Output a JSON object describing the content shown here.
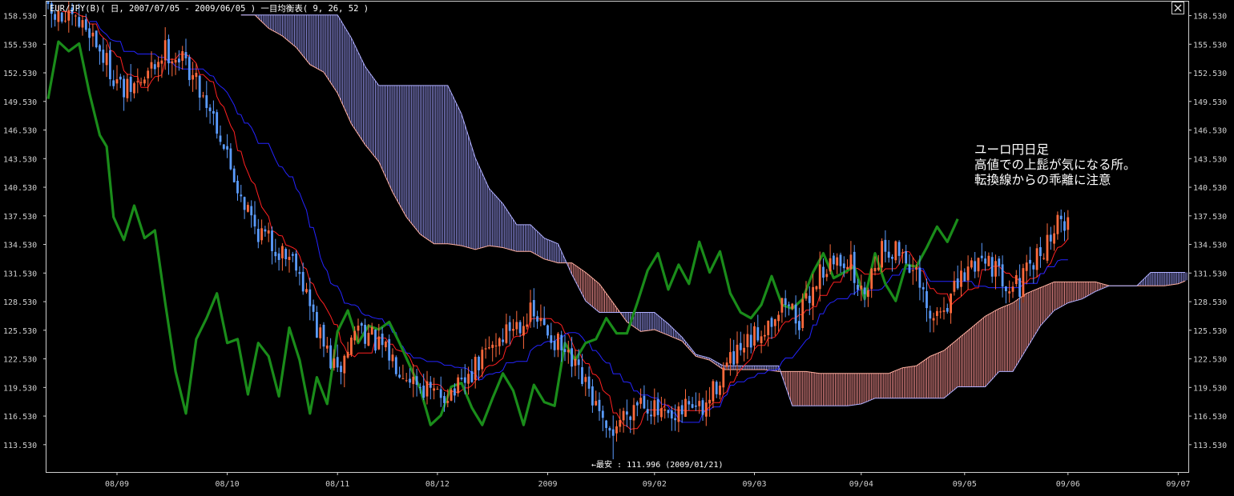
{
  "header": {
    "title": "EUR/JPY(B)( 日, 2007/07/05 - 2009/06/05 )   一目均衡表( 9, 26, 52 )"
  },
  "annotation": {
    "lines": [
      "ユーロ円日足",
      "高値での上髭が気になる所。",
      "転換線からの乖離に注意"
    ]
  },
  "low_marker": {
    "label": "←最安 : 111.996 (2009/01/21)",
    "value": 111.996,
    "date": "2009/01/21"
  },
  "colors": {
    "background": "#000000",
    "bull_candle": "#ff6a3c",
    "bear_candle": "#5b9cff",
    "tenkan": "#ff2020",
    "kijun": "#2424ff",
    "chikou": "#1a8c1a",
    "cloud_bearish": "#8f8fe6",
    "cloud_bullish": "#f08c8c",
    "axis_text": "#d0d0d0"
  },
  "chart_data": {
    "type": "candlestick",
    "indicator": "一目均衡表( 9, 26, 52 )",
    "symbol": "EUR/JPY(B)",
    "period": "2007/07/05 - 2009/06/05",
    "y_ticks": [
      "158.530",
      "155.530",
      "152.530",
      "149.530",
      "146.530",
      "143.530",
      "140.530",
      "137.530",
      "134.530",
      "131.530",
      "128.530",
      "125.530",
      "122.530",
      "119.530",
      "116.530",
      "113.530"
    ],
    "x_ticks": [
      "08/09",
      "08/10",
      "08/11",
      "08/12",
      "2009",
      "09/02",
      "09/03",
      "09/04",
      "09/05",
      "09/06",
      "09/07"
    ],
    "x_tick_index": [
      20,
      52,
      84,
      113,
      145,
      176,
      205,
      236,
      266,
      296,
      328
    ],
    "ylim": [
      111.2,
      160.0
    ],
    "n_bars": 330,
    "price_anchors": [
      [
        0,
        158.6
      ],
      [
        12,
        157.2
      ],
      [
        16,
        154.2
      ],
      [
        22,
        150.4
      ],
      [
        28,
        151.8
      ],
      [
        34,
        155.0
      ],
      [
        40,
        153.6
      ],
      [
        48,
        148.2
      ],
      [
        54,
        141.6
      ],
      [
        60,
        136.4
      ],
      [
        66,
        134.2
      ],
      [
        72,
        133.0
      ],
      [
        78,
        125.6
      ],
      [
        84,
        120.8
      ],
      [
        90,
        126.2
      ],
      [
        96,
        123.8
      ],
      [
        104,
        121.2
      ],
      [
        112,
        118.6
      ],
      [
        120,
        119.4
      ],
      [
        128,
        123.6
      ],
      [
        134,
        125.8
      ],
      [
        140,
        127.2
      ],
      [
        146,
        125.0
      ],
      [
        152,
        121.8
      ],
      [
        158,
        118.4
      ],
      [
        162,
        114.2
      ],
      [
        166,
        116.2
      ],
      [
        172,
        118.6
      ],
      [
        178,
        116.4
      ],
      [
        182,
        115.6
      ],
      [
        186,
        118.2
      ],
      [
        190,
        116.8
      ],
      [
        196,
        121.4
      ],
      [
        202,
        123.4
      ],
      [
        208,
        126.0
      ],
      [
        214,
        128.6
      ],
      [
        218,
        126.6
      ],
      [
        224,
        131.8
      ],
      [
        232,
        133.2
      ],
      [
        236,
        129.2
      ],
      [
        242,
        134.2
      ],
      [
        248,
        133.8
      ],
      [
        252,
        131.0
      ],
      [
        256,
        126.2
      ],
      [
        262,
        129.0
      ],
      [
        268,
        132.4
      ],
      [
        272,
        133.6
      ],
      [
        276,
        131.2
      ],
      [
        282,
        130.2
      ],
      [
        288,
        133.6
      ],
      [
        292,
        136.2
      ],
      [
        296,
        137.4
      ]
    ],
    "chikou_anchors": [
      [
        0,
        149.8
      ],
      [
        3,
        155.8
      ],
      [
        6,
        154.8
      ],
      [
        9,
        155.6
      ],
      [
        12,
        150.4
      ],
      [
        15,
        146.0
      ],
      [
        17,
        144.8
      ],
      [
        19,
        137.4
      ],
      [
        22,
        135.0
      ],
      [
        25,
        138.6
      ],
      [
        28,
        135.2
      ],
      [
        31,
        136.0
      ],
      [
        34,
        128.4
      ],
      [
        37,
        121.2
      ],
      [
        40,
        116.8
      ],
      [
        43,
        124.6
      ],
      [
        46,
        126.8
      ],
      [
        49,
        129.4
      ],
      [
        52,
        124.2
      ],
      [
        55,
        124.6
      ],
      [
        58,
        118.8
      ],
      [
        61,
        124.2
      ],
      [
        64,
        122.8
      ],
      [
        67,
        118.6
      ],
      [
        70,
        125.8
      ],
      [
        73,
        122.4
      ],
      [
        76,
        116.8
      ],
      [
        78,
        120.6
      ],
      [
        81,
        117.8
      ],
      [
        84,
        125.4
      ],
      [
        87,
        127.6
      ],
      [
        90,
        124.2
      ],
      [
        93,
        126.0
      ],
      [
        96,
        125.6
      ],
      [
        99,
        126.4
      ],
      [
        102,
        124.2
      ],
      [
        105,
        121.8
      ],
      [
        108,
        119.4
      ],
      [
        111,
        115.6
      ],
      [
        114,
        116.6
      ],
      [
        117,
        119.6
      ],
      [
        120,
        120.0
      ],
      [
        123,
        117.4
      ],
      [
        126,
        115.6
      ],
      [
        129,
        118.4
      ],
      [
        132,
        121.0
      ],
      [
        135,
        119.2
      ],
      [
        138,
        115.6
      ],
      [
        141,
        119.8
      ],
      [
        144,
        118.0
      ],
      [
        147,
        117.6
      ],
      [
        150,
        124.2
      ],
      [
        153,
        122.4
      ],
      [
        156,
        124.2
      ],
      [
        159,
        124.6
      ],
      [
        162,
        126.8
      ],
      [
        165,
        125.2
      ],
      [
        168,
        125.2
      ],
      [
        171,
        128.4
      ],
      [
        174,
        131.8
      ],
      [
        177,
        133.6
      ],
      [
        180,
        129.8
      ],
      [
        183,
        132.4
      ],
      [
        186,
        130.4
      ],
      [
        189,
        134.8
      ],
      [
        192,
        131.6
      ],
      [
        195,
        133.8
      ],
      [
        198,
        129.4
      ],
      [
        201,
        127.4
      ],
      [
        204,
        126.8
      ],
      [
        207,
        128.2
      ],
      [
        210,
        131.2
      ],
      [
        213,
        128.2
      ],
      [
        216,
        127.8
      ],
      [
        219,
        128.8
      ],
      [
        222,
        131.6
      ],
      [
        225,
        133.6
      ],
      [
        228,
        131.0
      ],
      [
        231,
        131.6
      ],
      [
        234,
        132.2
      ],
      [
        237,
        128.8
      ],
      [
        240,
        133.6
      ],
      [
        243,
        130.4
      ],
      [
        246,
        128.6
      ],
      [
        249,
        132.4
      ],
      [
        252,
        132.2
      ],
      [
        255,
        134.2
      ],
      [
        258,
        136.4
      ],
      [
        261,
        134.8
      ],
      [
        264,
        137.2
      ]
    ],
    "cloud_a_anchors": [
      [
        56,
        158.6
      ],
      [
        60,
        158.6
      ],
      [
        64,
        157.2
      ],
      [
        68,
        156.4
      ],
      [
        72,
        155.2
      ],
      [
        76,
        153.4
      ],
      [
        80,
        152.6
      ],
      [
        84,
        150.4
      ],
      [
        88,
        147.2
      ],
      [
        92,
        145.0
      ],
      [
        96,
        143.2
      ],
      [
        100,
        140.0
      ],
      [
        104,
        137.4
      ],
      [
        108,
        135.6
      ],
      [
        112,
        134.6
      ],
      [
        116,
        134.6
      ],
      [
        120,
        134.4
      ],
      [
        124,
        134.0
      ],
      [
        128,
        134.4
      ],
      [
        132,
        134.2
      ],
      [
        136,
        133.8
      ],
      [
        140,
        133.8
      ],
      [
        144,
        133.0
      ],
      [
        148,
        132.6
      ],
      [
        152,
        132.6
      ],
      [
        156,
        131.6
      ],
      [
        160,
        130.4
      ],
      [
        164,
        128.4
      ],
      [
        168,
        126.4
      ],
      [
        172,
        125.4
      ],
      [
        176,
        125.6
      ],
      [
        180,
        125.0
      ],
      [
        184,
        124.4
      ],
      [
        188,
        122.8
      ],
      [
        192,
        122.4
      ],
      [
        196,
        121.4
      ],
      [
        200,
        121.4
      ],
      [
        204,
        121.4
      ],
      [
        208,
        121.4
      ],
      [
        212,
        121.2
      ],
      [
        216,
        121.2
      ],
      [
        220,
        121.2
      ],
      [
        224,
        121.0
      ],
      [
        228,
        121.0
      ],
      [
        232,
        121.0
      ],
      [
        236,
        121.0
      ],
      [
        240,
        121.0
      ],
      [
        244,
        121.0
      ],
      [
        248,
        121.6
      ],
      [
        252,
        121.8
      ],
      [
        256,
        122.8
      ],
      [
        260,
        123.4
      ],
      [
        264,
        124.6
      ],
      [
        268,
        125.8
      ],
      [
        272,
        127.0
      ],
      [
        276,
        127.8
      ],
      [
        280,
        128.4
      ],
      [
        284,
        129.4
      ],
      [
        288,
        130.0
      ],
      [
        292,
        130.6
      ],
      [
        296,
        130.6
      ],
      [
        300,
        130.6
      ],
      [
        304,
        130.6
      ],
      [
        308,
        130.2
      ],
      [
        312,
        130.2
      ],
      [
        316,
        130.2
      ],
      [
        320,
        130.2
      ],
      [
        324,
        130.2
      ],
      [
        328,
        130.4
      ],
      [
        332,
        131.0
      ],
      [
        336,
        131.6
      ],
      [
        340,
        131.6
      ],
      [
        344,
        131.6
      ]
    ],
    "cloud_b_anchors": [
      [
        56,
        158.6
      ],
      [
        60,
        158.6
      ],
      [
        64,
        158.6
      ],
      [
        68,
        158.6
      ],
      [
        72,
        158.6
      ],
      [
        76,
        158.6
      ],
      [
        80,
        158.6
      ],
      [
        84,
        158.6
      ],
      [
        88,
        156.2
      ],
      [
        92,
        153.2
      ],
      [
        96,
        151.2
      ],
      [
        100,
        151.2
      ],
      [
        104,
        151.2
      ],
      [
        108,
        151.2
      ],
      [
        112,
        151.2
      ],
      [
        116,
        151.2
      ],
      [
        120,
        148.2
      ],
      [
        124,
        143.6
      ],
      [
        128,
        140.4
      ],
      [
        132,
        138.8
      ],
      [
        136,
        136.6
      ],
      [
        140,
        136.6
      ],
      [
        144,
        135.2
      ],
      [
        148,
        134.6
      ],
      [
        152,
        131.4
      ],
      [
        156,
        128.6
      ],
      [
        160,
        127.4
      ],
      [
        164,
        127.4
      ],
      [
        168,
        127.4
      ],
      [
        172,
        127.4
      ],
      [
        176,
        127.4
      ],
      [
        180,
        126.2
      ],
      [
        184,
        124.8
      ],
      [
        188,
        123.0
      ],
      [
        192,
        122.6
      ],
      [
        196,
        121.8
      ],
      [
        200,
        121.8
      ],
      [
        204,
        121.8
      ],
      [
        208,
        121.8
      ],
      [
        212,
        121.8
      ],
      [
        216,
        117.6
      ],
      [
        220,
        117.6
      ],
      [
        224,
        117.6
      ],
      [
        228,
        117.6
      ],
      [
        232,
        117.6
      ],
      [
        236,
        117.8
      ],
      [
        240,
        118.4
      ],
      [
        244,
        118.4
      ],
      [
        248,
        118.4
      ],
      [
        252,
        118.4
      ],
      [
        256,
        118.4
      ],
      [
        260,
        118.4
      ],
      [
        264,
        119.6
      ],
      [
        268,
        119.6
      ],
      [
        272,
        119.6
      ],
      [
        276,
        121.2
      ],
      [
        280,
        121.2
      ],
      [
        284,
        123.6
      ],
      [
        288,
        126.0
      ],
      [
        292,
        127.6
      ],
      [
        296,
        128.4
      ],
      [
        300,
        128.8
      ],
      [
        304,
        129.6
      ],
      [
        308,
        130.2
      ],
      [
        312,
        130.2
      ],
      [
        316,
        130.2
      ],
      [
        320,
        131.6
      ],
      [
        324,
        131.6
      ],
      [
        328,
        131.6
      ],
      [
        332,
        131.6
      ],
      [
        336,
        131.8
      ],
      [
        340,
        132.8
      ],
      [
        344,
        133.4
      ]
    ]
  }
}
